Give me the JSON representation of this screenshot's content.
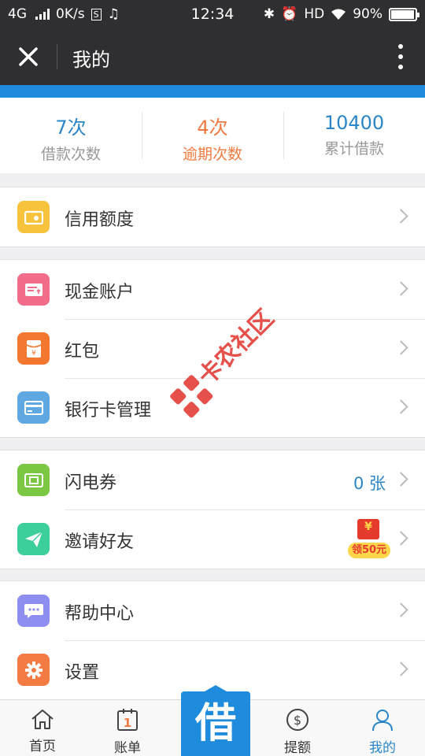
{
  "status_bar": {
    "network": "4G",
    "speed": "0K/s",
    "time": "12:34",
    "hd": "HD",
    "battery": "90%",
    "battery_level": 0.9
  },
  "header": {
    "title": "我的"
  },
  "stats": [
    {
      "value": "7次",
      "label": "借款次数"
    },
    {
      "value": "4次",
      "label": "逾期次数"
    },
    {
      "value": "10400",
      "label": "累计借款"
    }
  ],
  "menu": {
    "credit": {
      "label": "信用额度",
      "icon": "wallet-icon",
      "color": "#f7c33c"
    },
    "cash_account": {
      "label": "现金账户",
      "icon": "card-upload-icon",
      "color": "#f26d8a"
    },
    "red_packet": {
      "label": "红包",
      "icon": "red-envelope-icon",
      "color": "#f3772f"
    },
    "bank_card": {
      "label": "银行卡管理",
      "icon": "bank-card-icon",
      "color": "#5fa8e2"
    },
    "flash_coupon": {
      "label": "闪电券",
      "icon": "ticket-icon",
      "color": "#7bc642",
      "value": "0 张"
    },
    "invite": {
      "label": "邀请好友",
      "icon": "paper-plane-icon",
      "color": "#3ccf9a",
      "badge_yen": "¥",
      "badge_text": "领50元"
    },
    "help": {
      "label": "帮助中心",
      "icon": "chat-bubble-icon",
      "color": "#8e8ef0"
    },
    "settings": {
      "label": "设置",
      "icon": "gear-icon",
      "color": "#f57b45"
    }
  },
  "tabbar": {
    "home": "首页",
    "bill": "账单",
    "bill_icon_number": "1",
    "borrow": "借",
    "withdraw": "提额",
    "mine": "我的"
  },
  "watermark": "卡农社区",
  "colors": {
    "accent": "#1e8bdc",
    "text_blue": "#2a86c8",
    "overdue_orange": "#f07a3f",
    "dark_bar": "#2f2f31"
  }
}
